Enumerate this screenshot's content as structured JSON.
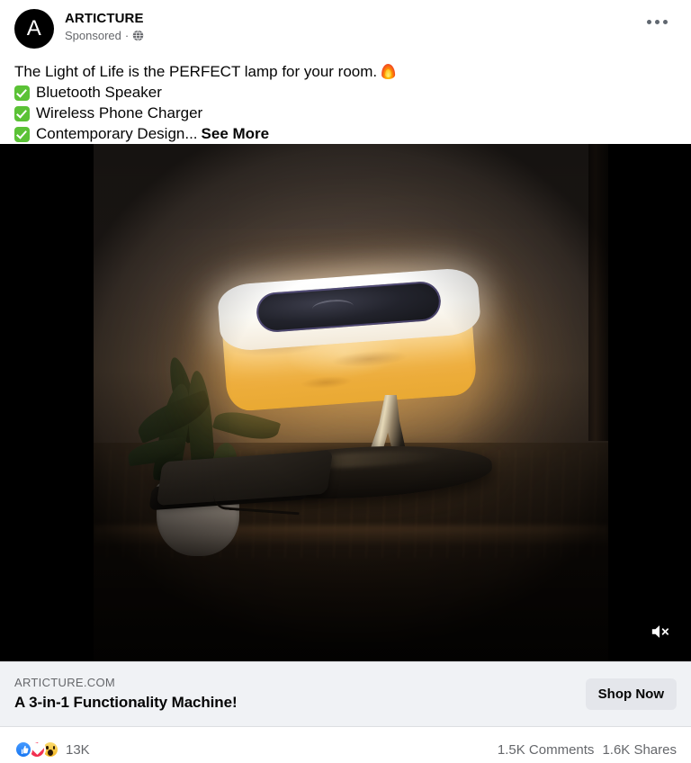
{
  "header": {
    "avatar_letter": "A",
    "page_name": "ARTICTURE",
    "sponsored_label": "Sponsored",
    "separator": "·",
    "audience_icon": "globe-icon",
    "menu_icon": "more-options-icon"
  },
  "post": {
    "headline": "The Light of Life is the PERFECT lamp for your room.",
    "headline_emoji": "fire-emoji",
    "bullets": [
      "Bluetooth Speaker",
      "Wireless Phone Charger",
      "Contemporary Design..."
    ],
    "see_more_label": "See More"
  },
  "media": {
    "type": "video",
    "sound_state": "muted",
    "sound_icon": "speaker-muted-icon",
    "scene_description": "Glowing wood-grain table lamp with white rim and speaker panel on dark wooden table, potted plant at left, phone charging on base"
  },
  "link_card": {
    "domain": "ARTICTURE.COM",
    "title": "A 3-in-1 Functionality Machine!",
    "cta_label": "Shop Now"
  },
  "engagement": {
    "reactions": [
      {
        "name": "like",
        "color": "#1877f2"
      },
      {
        "name": "love",
        "color": "#f02849"
      },
      {
        "name": "wow",
        "color": "#f5b722"
      }
    ],
    "reaction_count": "13K",
    "comments": "1.5K Comments",
    "shares": "1.6K Shares"
  },
  "colors": {
    "brand_blue": "#1877f2",
    "text_primary": "#050505",
    "text_secondary": "#65676b",
    "card_bg": "#f0f2f5",
    "button_bg": "#e4e6eb",
    "check_green": "#5bc236"
  }
}
